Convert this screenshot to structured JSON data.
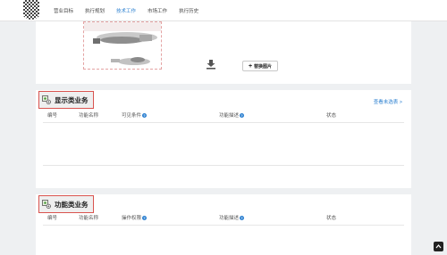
{
  "nav": {
    "items": [
      {
        "label": "营业目标",
        "active": false
      },
      {
        "label": "执行规划",
        "active": false
      },
      {
        "label": "技术工作",
        "active": true
      },
      {
        "label": "市场工作",
        "active": false
      },
      {
        "label": "执行历史",
        "active": false
      }
    ]
  },
  "media": {
    "replace_label": "替换图片"
  },
  "display_section": {
    "title": "显示类业务",
    "more_link": "查看未选表 >",
    "columns": [
      "编号",
      "功能名称",
      "可见条件",
      "功能描述",
      "状态"
    ]
  },
  "function_section": {
    "title": "功能类业务",
    "columns": [
      "编号",
      "功能名称",
      "操作权限",
      "功能描述",
      "状态"
    ]
  },
  "colors": {
    "accent": "#2a7fd0",
    "highlight_border": "#d9534f",
    "background": "#eef0f2"
  }
}
